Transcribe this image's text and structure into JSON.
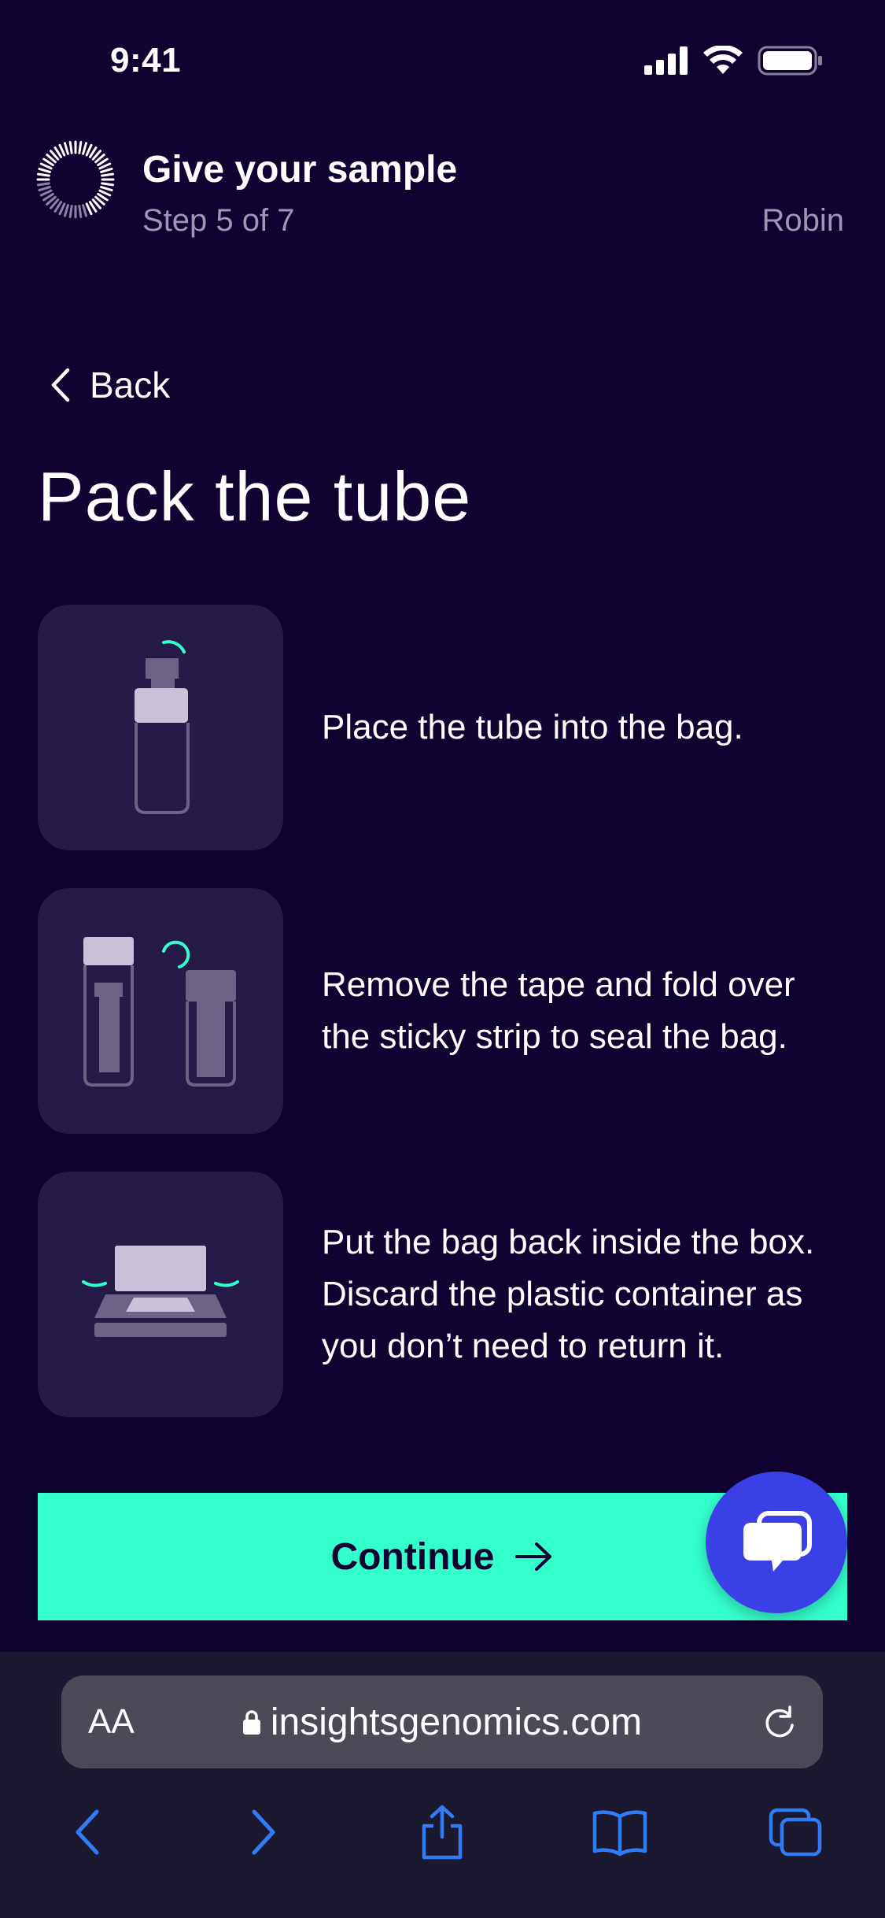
{
  "status_bar": {
    "time": "9:41"
  },
  "header": {
    "title": "Give your sample",
    "step": "Step 5 of 7",
    "user": "Robin",
    "progress": 0.714
  },
  "back": {
    "label": "Back"
  },
  "page": {
    "title": "Pack the tube"
  },
  "steps": [
    {
      "text": "Place the tube into the bag.",
      "icon": "tube-in-bag-illustration"
    },
    {
      "text": "Remove the tape and fold over the sticky strip to seal the bag.",
      "icon": "seal-bag-illustration"
    },
    {
      "text": "Put the bag back inside the box. Discard the plastic container as you don’t need to return it.",
      "icon": "bag-in-box-illustration"
    }
  ],
  "continue": {
    "label": "Continue"
  },
  "chat": {
    "icon": "chat-bubbles-icon"
  },
  "browser": {
    "text_size_label": "AA",
    "url": "insightsgenomics.com"
  },
  "colors": {
    "background": "#100332",
    "accent": "#33ffcc",
    "card": "#261a47",
    "chat": "#3b3fe6",
    "muted_text": "#9c97b3",
    "ios_blue": "#2f7cf6"
  }
}
